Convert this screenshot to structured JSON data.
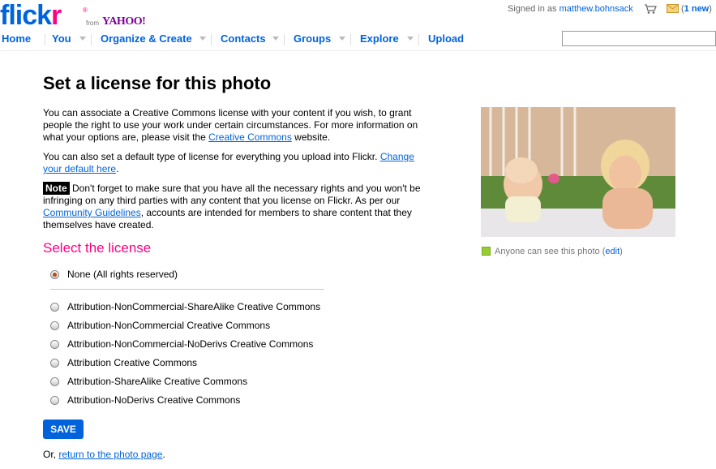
{
  "header": {
    "logo_parts": [
      "flick",
      "r"
    ],
    "logo_reg": "®",
    "logo_from": "from",
    "logo_yahoo": "YAHOO!",
    "signed_in_prefix": "Signed in as",
    "username": "matthew.bohnsack",
    "messages_open": "(",
    "messages_count": "1 new",
    "messages_close": ")",
    "icons": [
      "cart-icon",
      "mail-icon"
    ]
  },
  "nav": {
    "items": [
      "Home",
      "You",
      "Organize & Create",
      "Contacts",
      "Groups",
      "Explore",
      "Upload"
    ],
    "search_value": ""
  },
  "main": {
    "title": "Set a license for this photo",
    "intro_1": "You can associate a Creative Commons license with your content if you wish, to grant people the right to use your work under certain circumstances. For more information on what your options are, please visit the",
    "intro_link": "Creative Commons",
    "intro_2": "website.",
    "default_1": "You can also set a default type of license for everything you upload into Flickr.",
    "default_link": "Change your default here",
    "default_2": ".",
    "note_badge": "Note",
    "note_1": "Don't forget to make sure that you have all the necessary rights and you won't be infringing on any third parties with any content that you license on Flickr. As per our",
    "note_link": "Community Guidelines",
    "note_2": ", accounts are intended for members to share content that they themselves have created.",
    "select_title": "Select the license",
    "selected_option": "None (All rights reserved)",
    "options": [
      "Attribution-NonCommercial-ShareAlike Creative Commons",
      "Attribution-NonCommercial Creative Commons",
      "Attribution-NonCommercial-NoDerivs Creative Commons",
      "Attribution Creative Commons",
      "Attribution-ShareAlike Creative Commons",
      "Attribution-NoDerivs Creative Commons"
    ],
    "save_label": "SAVE",
    "return_prefix": "Or,",
    "return_link": "return to the photo page",
    "return_suffix": "."
  },
  "sidebar": {
    "privacy_text": "Anyone can see this photo",
    "privacy_open": "(",
    "privacy_edit": "edit",
    "privacy_close": ")"
  },
  "colors": {
    "link": "#0063dc",
    "accent_pink": "#ff0084",
    "save_button": "#0063dc"
  }
}
